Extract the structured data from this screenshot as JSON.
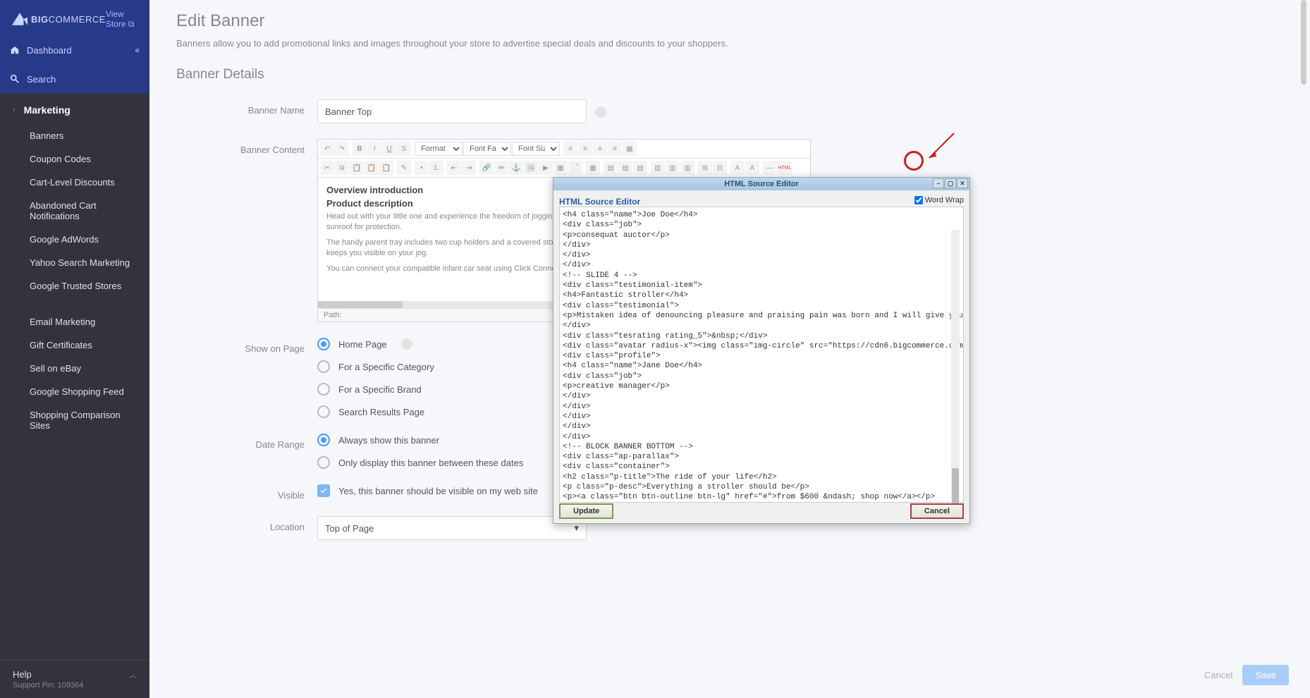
{
  "brand": {
    "text1": "BIG",
    "text2": "COMMERCE",
    "view_store": "View Store"
  },
  "nav": {
    "dashboard": "Dashboard",
    "search": "Search",
    "section": "Marketing",
    "items": [
      "Banners",
      "Coupon Codes",
      "Cart-Level Discounts",
      "Abandoned Cart Notifications",
      "Google AdWords",
      "Yahoo Search Marketing",
      "Google Trusted Stores"
    ],
    "items2": [
      "Email Marketing",
      "Gift Certificates",
      "Sell on eBay",
      "Google Shopping Feed",
      "Shopping Comparison Sites"
    ],
    "help": "Help",
    "help_sub": "Support Pin: 109364"
  },
  "page": {
    "title": "Edit Banner",
    "subtitle": "Banners allow you to add promotional links and images throughout your store to advertise special deals and discounts to your shoppers.",
    "section": "Banner Details"
  },
  "form": {
    "banner_name_label": "Banner Name",
    "banner_name_value": "Banner Top",
    "banner_content_label": "Banner Content",
    "show_on_label": "Show on Page",
    "show_opts": [
      "Home Page",
      "For a Specific Category",
      "For a Specific Brand",
      "Search Results Page"
    ],
    "date_label": "Date Range",
    "date_opts": [
      "Always show this banner",
      "Only display this banner between these dates"
    ],
    "visible_label": "Visible",
    "visible_text": "Yes, this banner should be visible on my web site",
    "location_label": "Location",
    "location_value": "Top of Page"
  },
  "editor": {
    "format": "Format",
    "font_family": "Font Family",
    "font_size": "Font Size",
    "overview": "Overview introduction",
    "prod_desc": "Product description",
    "p1": "Head out with your little one and experience the freedom of jogging with the Graco Relay Click Connect Jogging Stroller. The covered sunroof for protection.",
    "p2": "The handy parent tray includes two cup holders and a covered storage compartment to secure items while running; reflective material keeps you visible on your jog.",
    "p3": "You can connect your compatible infant car seat using Click Connect.",
    "path": "Path:"
  },
  "modal": {
    "title": "HTML Source Editor",
    "sub": "HTML Source Editor",
    "word_wrap": "Word Wrap",
    "update": "Update",
    "cancel": "Cancel",
    "source": "<h4 class=\"name\">Joe Doe</h4>\n<div class=\"job\">\n<p>consequat auctor</p>\n</div>\n</div>\n</div>\n<!-- SLIDE 4 -->\n<div class=\"testimonial-item\">\n<h4>Fantastic stroller</h4>\n<div class=\"testimonial\">\n<p>Mistaken idea of denouncing pleasure and praising pain was born and I will give you a complete account of the system.I wanted a stroller for me and my baby that was easy to take around and workout with. I would recommend buying a stroller like this for multiple uses.</p>\n</div>\n<div class=\"tesrating rating_5\">&nbsp;</div>\n<div class=\"avatar radius-x\"><img class=\"img-circle\" src=\"https://cdn6.bigcommerce.com/s-pem98hsuvh/product_images/uploaded_images/portrait1.jpg\" alt=\"Jane Doe\" /></div>\n<div class=\"profile\">\n<h4 class=\"name\">Jane Doe</h4>\n<div class=\"job\">\n<p>creative manager</p>\n</div>\n</div>\n</div>\n</div>\n</div>\n<!-- BLOCK BANNER BOTTOM -->\n<div class=\"ap-parallax\">\n<div class=\"container\">\n<h2 class=\"p-title\">The ride of your life</h2>\n<p class=\"p-desc\">Everything a stroller should be</p>\n<p><a class=\"btn btn-outline btn-lg\" href=\"#\">from $600 &ndash; shop now</a></p>\n</div>\n</div>"
  },
  "footer": {
    "cancel": "Cancel",
    "save": "Save"
  }
}
